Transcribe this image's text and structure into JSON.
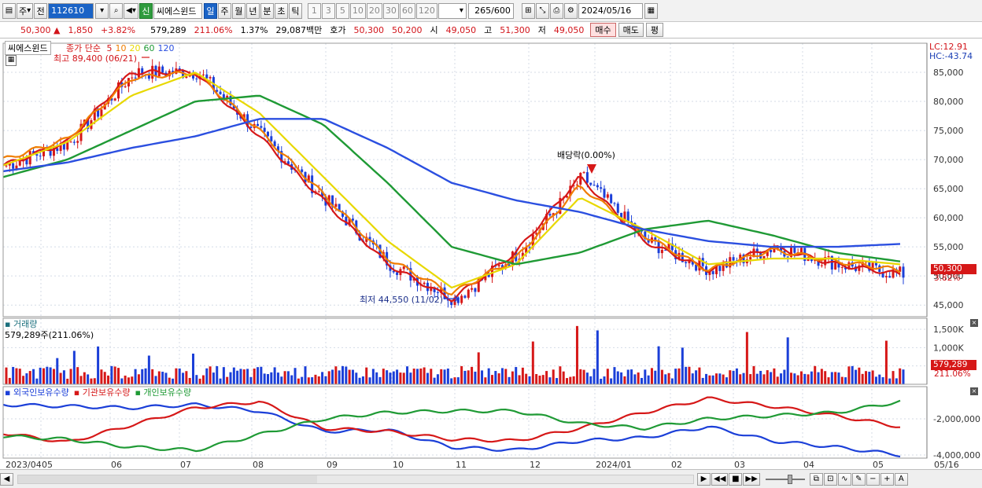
{
  "toolbar": {
    "market_label": "주",
    "prev_label": "전",
    "code": "112610",
    "stock_name": "씨에스윈드",
    "new_badge": "신",
    "period_tabs": [
      "일",
      "주",
      "월",
      "년",
      "분",
      "초",
      "틱"
    ],
    "active_period": "일",
    "interval_options": [
      "1",
      "3",
      "5",
      "10",
      "20",
      "30",
      "60",
      "120"
    ],
    "range_display": "265",
    "range_total": "/600",
    "date": "2024/05/16"
  },
  "quote": {
    "price": "50,300",
    "change_arrow": "▲",
    "change": "1,850",
    "change_pct": "+3.82%",
    "volume": "579,289",
    "volume_ratio": "211.06%",
    "turnover_rate": "1.37%",
    "trade_value": "29,087백만",
    "hoga_label": "호가",
    "ask": "50,300",
    "bid": "50,200",
    "open_label": "시",
    "open": "49,050",
    "high_label": "고",
    "high": "51,300",
    "low_label": "저",
    "low": "49,050",
    "buy_label": "매수",
    "sell_label": "매도",
    "eval_label": "평"
  },
  "price_panel": {
    "title": "씨에스윈드",
    "legend_prefix": "종가 단순",
    "ma_legend": [
      {
        "label": "5",
        "color": "#d61818"
      },
      {
        "label": "10",
        "color": "#f07d00"
      },
      {
        "label": "20",
        "color": "#e8d800"
      },
      {
        "label": "60",
        "color": "#1f9a35"
      },
      {
        "label": "120",
        "color": "#2b4fe0"
      }
    ],
    "high_annotation": "최고 89,400 (06/21)",
    "low_annotation": "최저 44,550 (11/02)",
    "dividend_annotation": "배당락(0.00%)",
    "lc_label": "LC:12.91",
    "hc_label": "HC:-43.74",
    "current_price_tag": "50,300",
    "current_pct_tag": "3.82%",
    "y_ticks": [
      "85,000",
      "80,000",
      "75,000",
      "70,000",
      "65,000",
      "60,000",
      "55,000",
      "50,000",
      "45,000"
    ]
  },
  "volume_panel": {
    "title": "거래량",
    "value_label": "579,289주(211.06%)",
    "y_ticks": [
      "1,500K",
      "1,000K",
      "500K"
    ],
    "current_tag": "579,289",
    "current_pct_tag": "211.06%"
  },
  "flow_panel": {
    "legend": [
      {
        "label": "외국인보유수량",
        "color": "#1b3fd8"
      },
      {
        "label": "기관보유수량",
        "color": "#d61818"
      },
      {
        "label": "개인보유수량",
        "color": "#1f9a35"
      }
    ],
    "y_ticks": [
      "-2,000,000",
      "-4,000,000"
    ]
  },
  "x_axis": {
    "labels": [
      "2023/04",
      "05",
      "06",
      "07",
      "08",
      "09",
      "10",
      "11",
      "12",
      "2024/01",
      "02",
      "03",
      "04",
      "05",
      "05/16"
    ]
  },
  "colors": {
    "up": "#d61818",
    "down": "#1b3fd8",
    "grid": "#d4dbe6"
  },
  "chart_data": {
    "type": "line",
    "title": "씨에스윈드",
    "x": [
      "2023/04",
      "05",
      "06",
      "07",
      "08",
      "09",
      "10",
      "11",
      "12",
      "2024/01",
      "02",
      "03",
      "04",
      "05",
      "05/16"
    ],
    "series": [
      {
        "name": "5",
        "values": [
          69000,
          73000,
          85000,
          85000,
          74000,
          63000,
          52000,
          46000,
          54000,
          67000,
          56000,
          51000,
          55000,
          52000,
          50300
        ]
      },
      {
        "name": "10",
        "values": [
          70000,
          73500,
          84000,
          85000,
          75000,
          64000,
          53000,
          47000,
          53000,
          65500,
          57000,
          51000,
          54500,
          52500,
          51000
        ]
      },
      {
        "name": "20",
        "values": [
          69000,
          73000,
          81000,
          85000,
          78000,
          67000,
          56000,
          48000,
          52000,
          63500,
          58000,
          52000,
          53000,
          53000,
          52000
        ]
      },
      {
        "name": "60",
        "values": [
          67000,
          70000,
          75000,
          80000,
          81000,
          76000,
          66000,
          55000,
          52000,
          54000,
          58000,
          59500,
          57000,
          54000,
          52500
        ]
      },
      {
        "name": "120",
        "values": [
          68000,
          69500,
          72000,
          74000,
          77000,
          77000,
          72000,
          66000,
          63000,
          61000,
          58000,
          56000,
          55000,
          55000,
          55500
        ]
      }
    ],
    "extremes": {
      "high": 89400,
      "high_date": "06/21",
      "low": 44550,
      "low_date": "11/02"
    },
    "ylim": [
      43000,
      90000
    ],
    "grid": true,
    "legend": "top-left"
  }
}
